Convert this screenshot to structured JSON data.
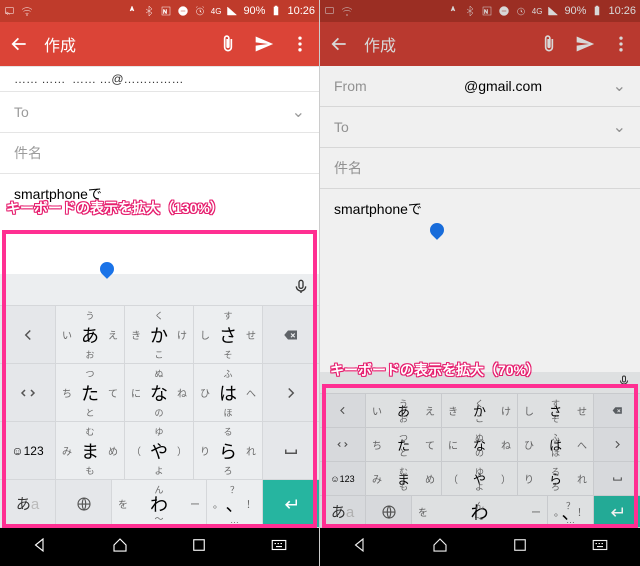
{
  "status": {
    "battery": "90%",
    "time": "10:26",
    "net": "4G"
  },
  "appbar": {
    "title": "作成"
  },
  "compose": {
    "from_label": "From",
    "from_domain": "@gmail.com",
    "to_label": "To",
    "subject_label": "件名",
    "body_text": "smartphoneで"
  },
  "captions": {
    "left": "キーボードの表示を拡大（130%）",
    "right": "キーボードの表示を拡大（70%）"
  },
  "keyboard": {
    "mode_label": "☺123",
    "lang_jp": "あ",
    "lang_en": "a",
    "rows": [
      [
        {
          "side": "arrow-left"
        },
        {
          "t": "う",
          "l": "い",
          "m": "あ",
          "r": "え",
          "b": "お"
        },
        {
          "t": "く",
          "l": "き",
          "m": "か",
          "r": "け",
          "b": "こ"
        },
        {
          "t": "す",
          "l": "し",
          "m": "さ",
          "r": "せ",
          "b": "そ"
        },
        {
          "side": "backspace"
        }
      ],
      [
        {
          "side": "arrow-lr"
        },
        {
          "t": "つ",
          "l": "ち",
          "m": "た",
          "r": "て",
          "b": "と"
        },
        {
          "t": "ぬ",
          "l": "に",
          "m": "な",
          "r": "ね",
          "b": "の"
        },
        {
          "t": "ふ",
          "l": "ひ",
          "m": "は",
          "r": "へ",
          "b": "ほ"
        },
        {
          "side": "arrow-right"
        }
      ],
      [
        {
          "side": "mode"
        },
        {
          "t": "む",
          "l": "み",
          "m": "ま",
          "r": "め",
          "b": "も"
        },
        {
          "t": "ゆ",
          "l": "（",
          "m": "や",
          "r": "）",
          "b": "よ"
        },
        {
          "t": "る",
          "l": "り",
          "m": "ら",
          "r": "れ",
          "b": "ろ"
        },
        {
          "side": "space"
        }
      ]
    ],
    "row4": [
      {
        "side": "lang"
      },
      {
        "side": "globe"
      },
      {
        "t": "ん",
        "l": "を",
        "m": "わ",
        "r": "ー",
        "b": "〜"
      },
      {
        "t": "？",
        "l": "。",
        "m": "、",
        "r": "！",
        "b": "…"
      },
      {
        "side": "enter"
      }
    ]
  }
}
